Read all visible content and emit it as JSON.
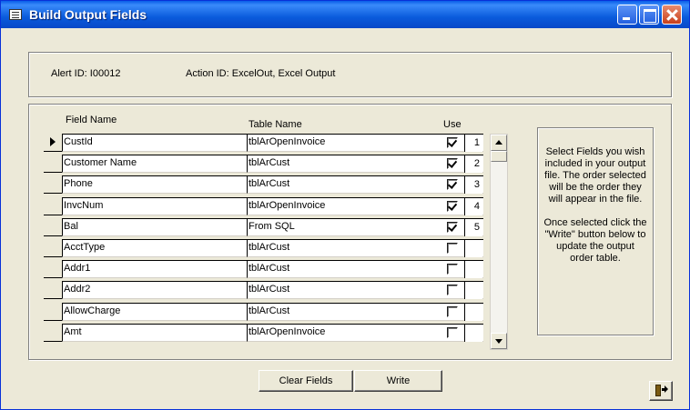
{
  "window": {
    "title": "Build Output Fields"
  },
  "header": {
    "alert_id": "Alert ID:  I00012",
    "action_id": "Action ID:  ExcelOut, Excel Output"
  },
  "columns": {
    "field_name": "Field Name",
    "table_name": "Table Name",
    "use": "Use"
  },
  "rows": [
    {
      "field": "CustId",
      "table": "tblArOpenInvoice",
      "use": true,
      "order": "1",
      "current": true
    },
    {
      "field": "Customer Name",
      "table": "tblArCust",
      "use": true,
      "order": "2"
    },
    {
      "field": "Phone",
      "table": "tblArCust",
      "use": true,
      "order": "3"
    },
    {
      "field": "InvcNum",
      "table": "tblArOpenInvoice",
      "use": true,
      "order": "4"
    },
    {
      "field": "Bal",
      "table": "From SQL",
      "use": true,
      "order": "5"
    },
    {
      "field": "AcctType",
      "table": "tblArCust",
      "use": false,
      "order": ""
    },
    {
      "field": "Addr1",
      "table": "tblArCust",
      "use": false,
      "order": ""
    },
    {
      "field": "Addr2",
      "table": "tblArCust",
      "use": false,
      "order": ""
    },
    {
      "field": "AllowCharge",
      "table": "tblArCust",
      "use": false,
      "order": ""
    },
    {
      "field": "Amt",
      "table": "tblArOpenInvoice",
      "use": false,
      "order": ""
    }
  ],
  "help": {
    "p1": "Select Fields you wish included in your output file. The order selected will be the order they will appear in the file.",
    "p2": "Once selected click the \"Write\" button below to update the output order table."
  },
  "buttons": {
    "clear": "Clear Fields",
    "write": "Write",
    "exit_icon": "exit-door-icon"
  },
  "colors": {
    "titlebar": "#0a5ee8",
    "face": "#ece9d8",
    "close": "#c8401c"
  }
}
